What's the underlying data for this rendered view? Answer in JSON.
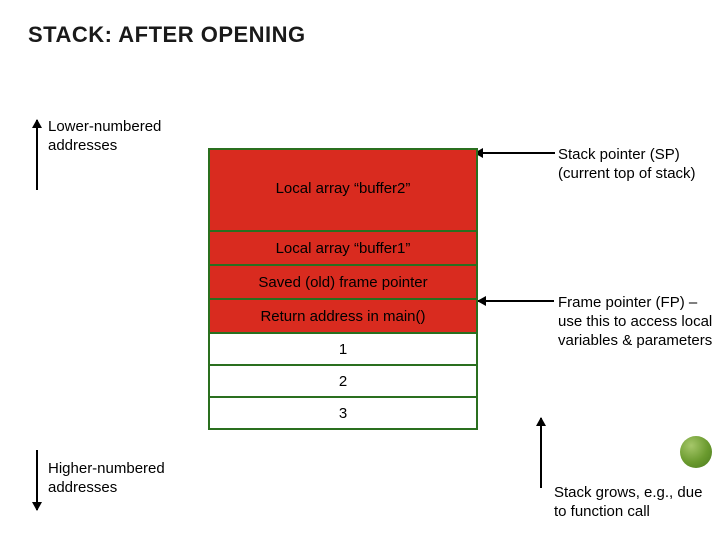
{
  "title": "STACK: AFTER OPENING",
  "labels": {
    "lower": "Lower-numbered addresses",
    "higher": "Higher-numbered addresses",
    "sp": "Stack pointer (SP) (current top of stack)",
    "fp": "Frame pointer (FP) – use this to access local variables & parameters",
    "grow": "Stack grows, e.g., due to function call"
  },
  "stack": {
    "buffer2": "Local array “buffer2”",
    "buffer1": "Local array “buffer1”",
    "saved_fp": "Saved (old) frame pointer",
    "return_addr": "Return address in main()",
    "arg1": "1",
    "arg2": "2",
    "arg3": "3"
  }
}
